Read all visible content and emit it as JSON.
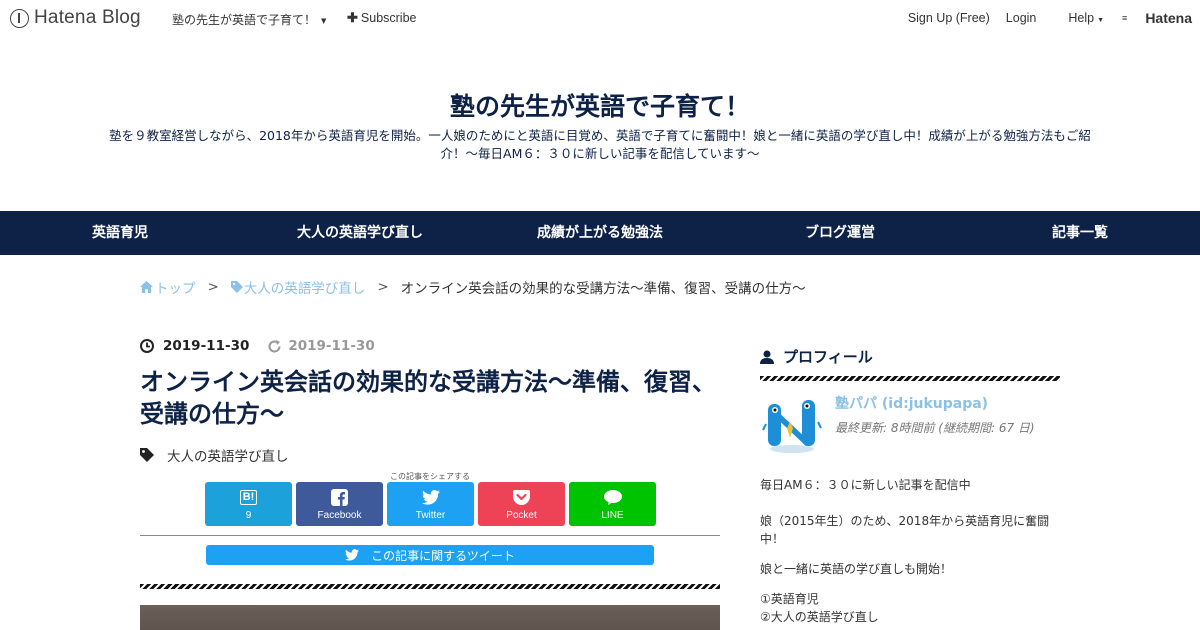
{
  "topbar": {
    "logo_text": "Hatena Blog",
    "blog_select": "塾の先生が英語で子育て！",
    "subscribe": "Subscribe",
    "signup": "Sign Up (Free)",
    "login": "Login",
    "help": "Help",
    "hatena": "Hatena"
  },
  "header": {
    "title": "塾の先生が英語で子育て！",
    "description": "塾を９教室経営しながら、2018年から英語育児を開始。一人娘のためにと英語に目覚め、英語で子育てに奮闘中！娘と一緒に英語の学び直し中！成績が上がる勉強方法もご紹介！～毎日AM６：３０に新しい記事を配信しています～"
  },
  "nav": {
    "items": [
      "英語育児",
      "大人の英語学び直し",
      "成績が上がる勉強法",
      "ブログ運営",
      "記事一覧"
    ]
  },
  "breadcrumb": {
    "home": "トップ",
    "category": "大人の英語学び直し",
    "current": "オンライン英会話の効果的な受講方法～準備、復習、受講の仕方～"
  },
  "article": {
    "date_published": "2019-11-30",
    "date_updated": "2019-11-30",
    "title": "オンライン英会話の効果的な受講方法～準備、復習、受講の仕方～",
    "category": "大人の英語学び直し",
    "share_caption": "この記事をシェアする",
    "share": {
      "hatena_count": "9",
      "facebook": "Facebook",
      "twitter": "Twitter",
      "pocket": "Pocket",
      "line": "LINE"
    },
    "tweet_bar": "この記事に関するツイート"
  },
  "sidebar": {
    "profile_heading": "プロフィール",
    "profile_name": "塾パパ (id:jukupapa)",
    "profile_meta": "最終更新: 8時間前 (継続期間: 67 日)",
    "lines": [
      "毎日AM６：３０に新しい記事を配信中",
      "娘（2015年生）のため、2018年から英語育児に奮闘中！",
      "娘と一緒に英語の学び直しも開始！",
      "①英語育児",
      "②大人の英語学び直し"
    ]
  },
  "colors": {
    "navy": "#0e2146",
    "link": "#8cc1e6",
    "hatena_bookmark": "#1da1da",
    "facebook": "#3e5a9a",
    "twitter": "#1da1f2",
    "pocket": "#ee4256",
    "line": "#00c300"
  }
}
